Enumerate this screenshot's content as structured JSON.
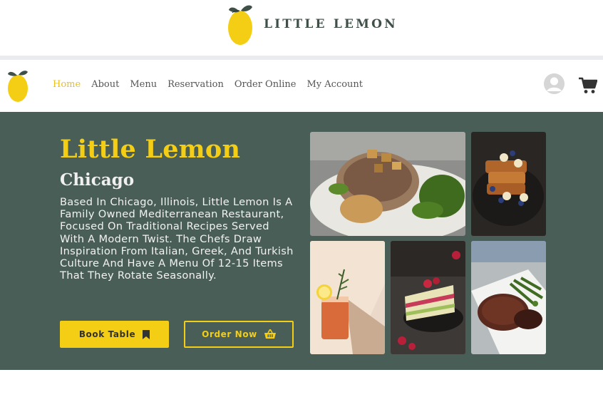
{
  "brand": {
    "name": "LITTLE LEMON",
    "logo_icon": "lemon-logo-icon"
  },
  "nav": {
    "items": [
      {
        "label": "Home",
        "active": true
      },
      {
        "label": "About",
        "active": false
      },
      {
        "label": "Menu",
        "active": false
      },
      {
        "label": "Reservation",
        "active": false
      },
      {
        "label": "Order Online",
        "active": false
      },
      {
        "label": "My Account",
        "active": false
      }
    ],
    "avatar_icon": "user-avatar-icon",
    "cart_icon": "shopping-cart-icon"
  },
  "hero": {
    "title": "Little Lemon",
    "subtitle": "Chicago",
    "description": "Based In Chicago, Illinois, Little Lemon Is A Family Owned Mediterranean Restaurant, Focused On Traditional Recipes Served With A Modern Twist. The Chefs Draw Inspiration From Italian, Greek, And Turkish Culture And Have A Menu Of 12-15 Items That They Rotate Seasonally.",
    "book_button": {
      "label": "Book Table",
      "icon": "bookmark-icon"
    },
    "order_button": {
      "label": "Order Now",
      "icon": "basket-icon"
    },
    "photos": [
      "grilled-pork-chop-photo",
      "french-toast-photo",
      "cocktail-photo",
      "layer-cake-photo",
      "steak-photo"
    ]
  },
  "colors": {
    "primary_green": "#495e57",
    "primary_yellow": "#f4ce14",
    "brand_text": "#3f5048"
  }
}
